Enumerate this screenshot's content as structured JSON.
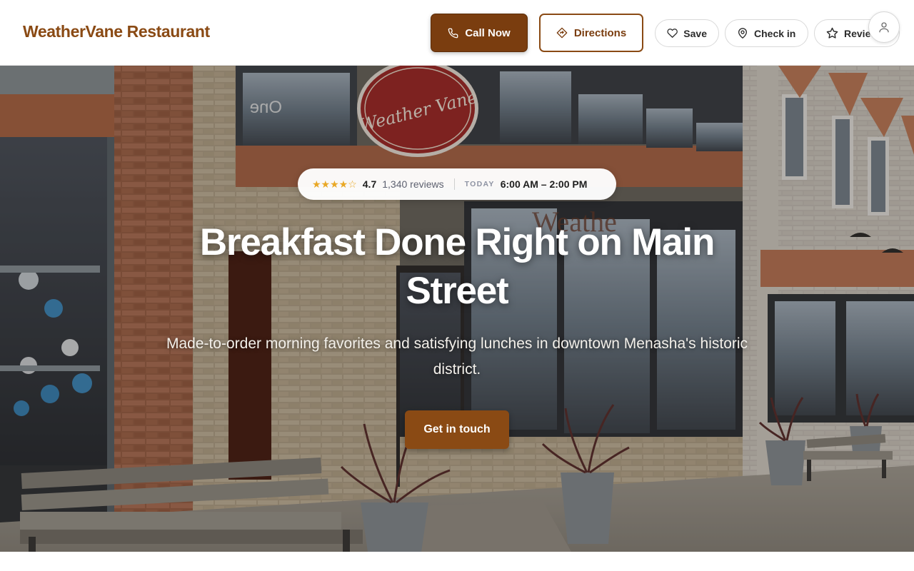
{
  "header": {
    "brand": "WeatherVane Restaurant",
    "call_label": "Call Now",
    "directions_label": "Directions",
    "save_label": "Save",
    "checkin_label": "Check in",
    "review_label": "Review"
  },
  "hero": {
    "rating_stars": "★★★★☆",
    "rating_value": "4.7",
    "review_count": "1,340 reviews",
    "today_label": "TODAY",
    "hours": "6:00 AM – 2:00 PM",
    "headline": "Breakfast Done Right on Main Street",
    "subheadline": "Made-to-order morning favorites and satisfying lunches in downtown Menasha's historic district.",
    "cta_label": "Get in touch",
    "photo_sign_text": "Weather Vane",
    "photo_window_text": "One"
  },
  "icons": {
    "call": "phone-icon",
    "directions": "directions-icon",
    "save": "heart-icon",
    "checkin": "map-pin-icon",
    "review": "star-icon",
    "avatar": "user-icon"
  },
  "colors": {
    "brand": "#8a4a14",
    "primary_button": "#7a3d0f",
    "star": "#e9a825"
  }
}
